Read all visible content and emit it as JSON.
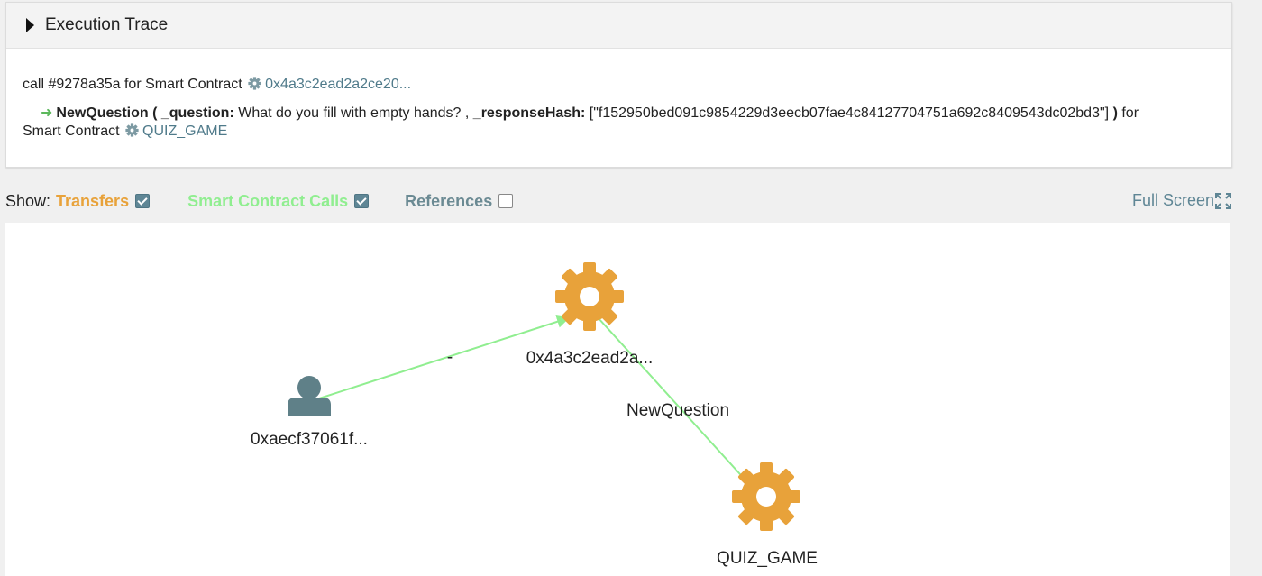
{
  "trace": {
    "title": "Execution Trace",
    "call_prefix": "call #9278a35a for Smart Contract",
    "call_address": "0x4a3c2ead2a2ce20...",
    "event": {
      "name": "NewQuestion",
      "open_paren": "(",
      "param1_name": "_question:",
      "param1_value": "What do you fill with empty hands? ,",
      "param2_name": "_responseHash:",
      "param2_value": "[\"f152950bed091c9854229d3eecb07fae4c84127704751a692c8409543dc02bd3\"]",
      "close_paren": ")",
      "suffix": "for",
      "target_prefix": "Smart Contract",
      "target_name": "QUIZ_GAME"
    }
  },
  "show": {
    "label": "Show:",
    "transfers": {
      "label": "Transfers",
      "checked": true
    },
    "calls": {
      "label": "Smart Contract Calls",
      "checked": true
    },
    "references": {
      "label": "References",
      "checked": false
    },
    "fullscreen": "Full Screen"
  },
  "graph": {
    "nodes": [
      {
        "id": "user",
        "type": "user-icon",
        "label": "0xaecf37061f..."
      },
      {
        "id": "contract",
        "type": "gear-icon",
        "label": "0x4a3c2ead2a..."
      },
      {
        "id": "quiz",
        "type": "gear-icon",
        "label": "QUIZ_GAME"
      }
    ],
    "edges": [
      {
        "from": "user",
        "to": "contract",
        "label": "-"
      },
      {
        "from": "contract",
        "to": "quiz",
        "label": "NewQuestion"
      }
    ]
  },
  "colors": {
    "gear": "#e8a23a",
    "user": "#5f8088",
    "edge": "#90ee90",
    "link": "#4f7a8a"
  }
}
